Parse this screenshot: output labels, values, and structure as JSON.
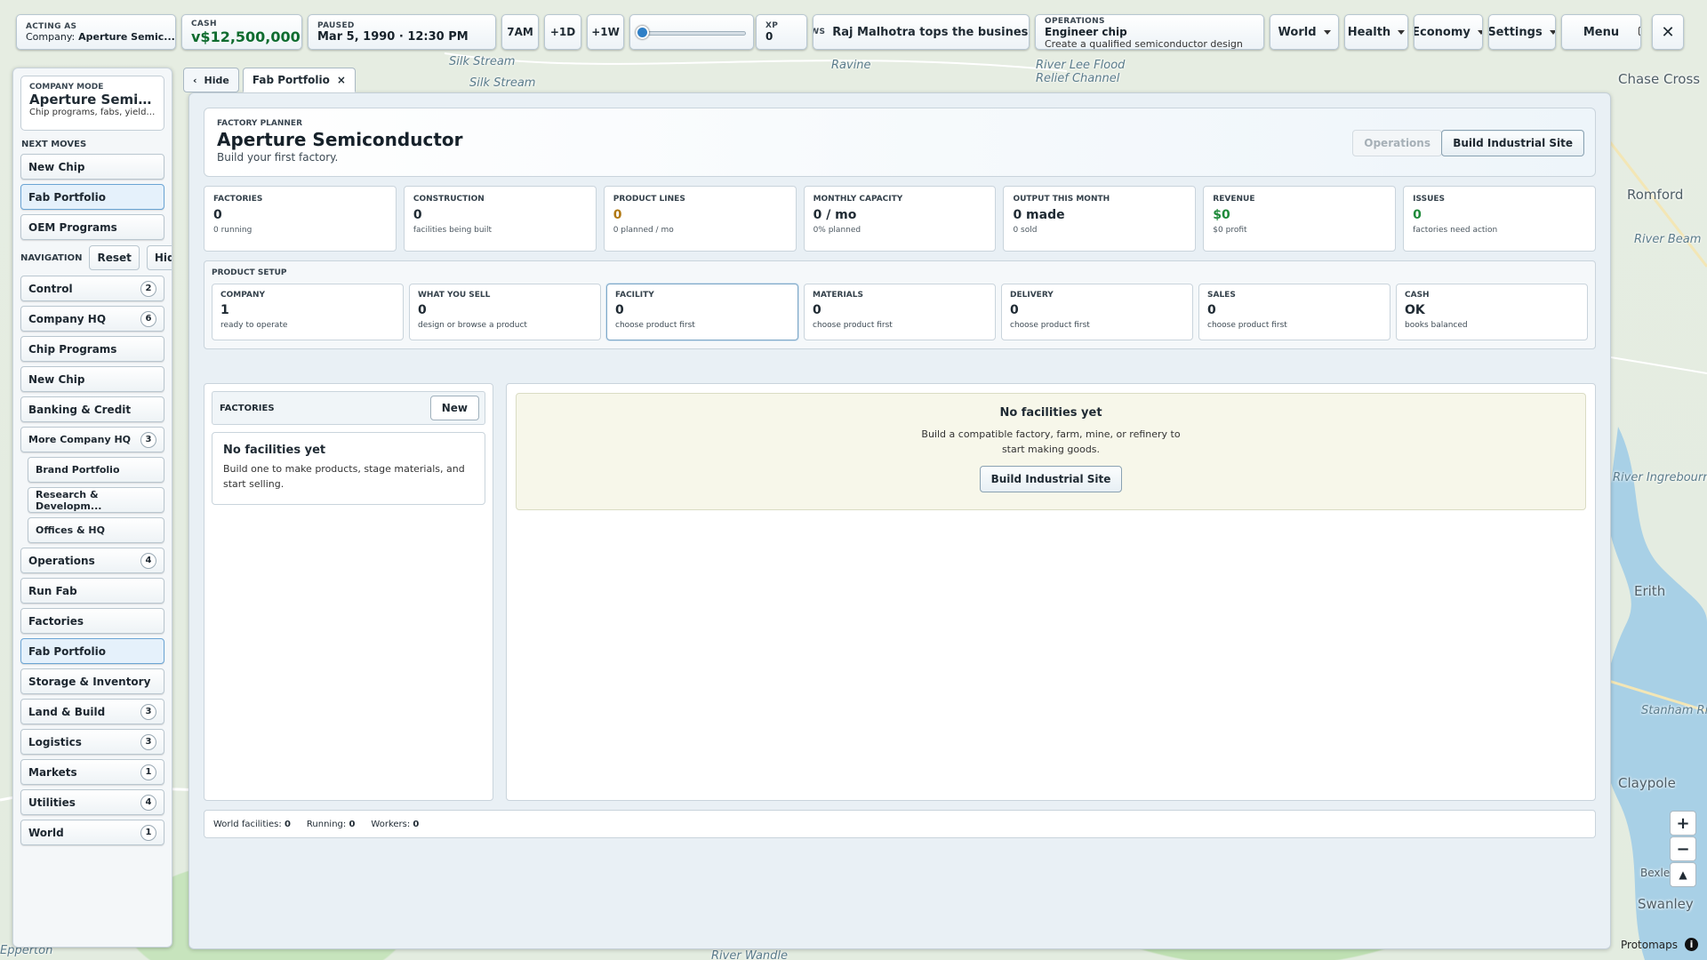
{
  "topbar": {
    "acting_as_label": "ACTING AS",
    "acting_as_value": "Company: Aperture Semic...",
    "company_prefix": "Company:",
    "company_name": "Aperture Semic...",
    "cash_label": "CASH",
    "cash_value": "v$12,500,000",
    "paused_label": "PAUSED",
    "paused_value": "Mar 5, 1990 · 12:30 PM",
    "btn_7am": "7AM",
    "btn_1d": "+1D",
    "btn_1w": "+1W",
    "xp_label": "XP",
    "xp_value": "0",
    "news_label": "NEWS",
    "news_text": "Raj Malhotra tops the business r",
    "ops_label": "OPERATIONS",
    "ops_title": "Engineer chip",
    "ops_sub": "Create a qualified semiconductor design",
    "menus": [
      "World",
      "Health",
      "Economy",
      "Settings"
    ],
    "menu_btn": "Menu"
  },
  "sidebar": {
    "mode_label": "COMPANY MODE",
    "mode_title": "Aperture Semicon...",
    "mode_sub": "Chip programs, fabs, yield, ...",
    "next_moves_label": "NEXT MOVES",
    "next_moves": [
      "New Chip",
      "Fab Portfolio",
      "OEM Programs"
    ],
    "nav_label": "NAVIGATION",
    "reset": "Reset",
    "hide": "Hide",
    "nav": [
      {
        "label": "Control",
        "badge": "2"
      },
      {
        "label": "Company HQ",
        "badge": "6"
      },
      {
        "label": "Chip Programs",
        "badge": ""
      },
      {
        "label": "New Chip",
        "badge": ""
      },
      {
        "label": "Banking & Credit",
        "badge": ""
      },
      {
        "label": "More Company HQ",
        "badge": "3"
      },
      {
        "label": "Brand Portfolio",
        "badge": ""
      },
      {
        "label": "Research & Developm...",
        "badge": ""
      },
      {
        "label": "Offices & HQ",
        "badge": ""
      },
      {
        "label": "Operations",
        "badge": "4"
      },
      {
        "label": "Run Fab",
        "badge": ""
      },
      {
        "label": "Factories",
        "badge": ""
      },
      {
        "label": "Fab Portfolio",
        "badge": ""
      },
      {
        "label": "Storage & Inventory",
        "badge": ""
      },
      {
        "label": "Land & Build",
        "badge": "3"
      },
      {
        "label": "Logistics",
        "badge": "3"
      },
      {
        "label": "Markets",
        "badge": "1"
      },
      {
        "label": "Utilities",
        "badge": "4"
      },
      {
        "label": "World",
        "badge": "1"
      }
    ]
  },
  "tabs": {
    "hide": "Hide",
    "active": "Fab Portfolio",
    "close": "×"
  },
  "header": {
    "kicker": "FACTORY PLANNER",
    "title": "Aperture Semiconductor",
    "subtitle": "Build your first factory.",
    "btn_operations": "Operations",
    "btn_build": "Build Industrial Site"
  },
  "stats": [
    {
      "label": "FACTORIES",
      "value": "0",
      "sub": "0 running"
    },
    {
      "label": "CONSTRUCTION",
      "value": "0",
      "sub": "facilities being built"
    },
    {
      "label": "PRODUCT LINES",
      "value": "0",
      "sub": "0 planned / mo"
    },
    {
      "label": "MONTHLY CAPACITY",
      "value": "0 / mo",
      "sub": "0% planned"
    },
    {
      "label": "OUTPUT THIS MONTH",
      "value": "0 made",
      "sub": "0 sold"
    },
    {
      "label": "REVENUE",
      "value": "$0",
      "sub": "$0 profit"
    },
    {
      "label": "ISSUES",
      "value": "0",
      "sub": "factories need action"
    }
  ],
  "setup": {
    "label": "PRODUCT SETUP",
    "cells": [
      {
        "label": "COMPANY",
        "value": "1",
        "sub": "ready to operate"
      },
      {
        "label": "WHAT YOU SELL",
        "value": "0",
        "sub": "design or browse a product"
      },
      {
        "label": "FACILITY",
        "value": "0",
        "sub": "choose product first"
      },
      {
        "label": "MATERIALS",
        "value": "0",
        "sub": "choose product first"
      },
      {
        "label": "DELIVERY",
        "value": "0",
        "sub": "choose product first"
      },
      {
        "label": "SALES",
        "value": "0",
        "sub": "choose product first"
      },
      {
        "label": "CASH",
        "value": "OK",
        "sub": "books balanced"
      }
    ]
  },
  "factories": {
    "label": "FACTORIES",
    "new_btn": "New",
    "empty_title": "No facilities yet",
    "empty_text": "Build one to make products, stage materials, and start selling."
  },
  "detail": {
    "empty_title": "No facilities yet",
    "empty_text": "Build a compatible factory, farm, mine, or refinery to start making goods.",
    "btn": "Build Industrial Site"
  },
  "footer": {
    "world_label": "World facilities:",
    "world_value": "0",
    "running_label": "Running:",
    "running_value": "0",
    "workers_label": "Workers:",
    "workers_value": "0"
  },
  "map": {
    "labels": [
      "Silk Stream",
      "Silk Stream",
      "Ravine",
      "River Lee Flood Relief Channel",
      "Chase Cross",
      "Romford",
      "River Beam",
      "River Ingrebourne",
      "Erith",
      "Stanham River",
      "Swanley",
      "Bexley",
      "Claypole",
      "River Wandle",
      "Epperton"
    ],
    "attribution": "Protomaps"
  },
  "colors": {
    "accent": "#2f7fc6",
    "cash_green": "#0f6c2f",
    "revenue_green": "#1f8a3a",
    "warning_amber": "#b07710"
  }
}
